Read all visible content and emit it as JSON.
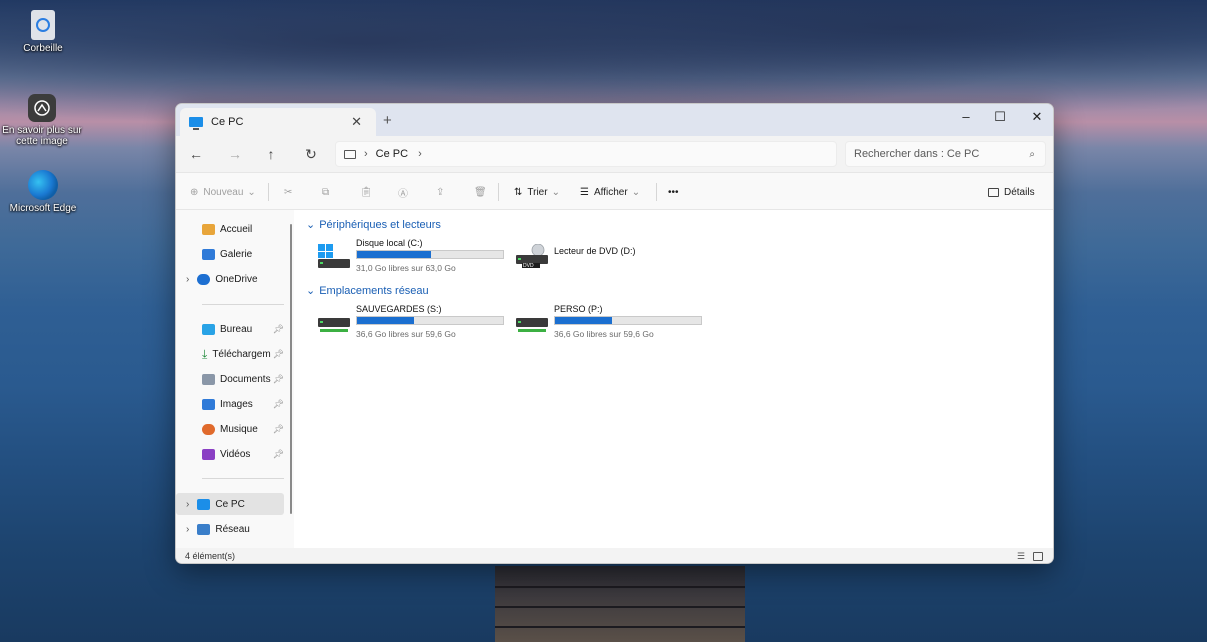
{
  "desktop": {
    "icons": [
      {
        "label": "Corbeille",
        "icon": "recycle-bin-icon"
      },
      {
        "label": "En savoir plus sur cette image",
        "icon": "learn-more-icon"
      },
      {
        "label": "Microsoft Edge",
        "icon": "edge-icon"
      }
    ]
  },
  "window": {
    "tab_title": "Ce PC",
    "tab_close": "✕",
    "new_tab": "+",
    "controls": {
      "minimize": "–",
      "maximize": "☐",
      "close": "✕"
    },
    "breadcrumb": [
      "Ce PC"
    ],
    "search_placeholder": "Rechercher dans : Ce PC",
    "toolbar": {
      "new_label": "Nouveau",
      "sort_label": "Trier",
      "view_label": "Afficher",
      "more_label": "•••",
      "details_label": "Détails"
    },
    "sidebar": {
      "items": [
        {
          "label": "Accueil"
        },
        {
          "label": "Galerie"
        },
        {
          "label": "OneDrive"
        },
        {
          "label": "Bureau"
        },
        {
          "label": "Téléchargem"
        },
        {
          "label": "Documents"
        },
        {
          "label": "Images"
        },
        {
          "label": "Musique"
        },
        {
          "label": "Vidéos"
        },
        {
          "label": "Ce PC"
        },
        {
          "label": "Réseau"
        }
      ]
    },
    "groups": [
      {
        "header": "Périphériques et lecteurs",
        "items": [
          {
            "name": "Disque local (C:)",
            "free": "31,0 Go libres sur 63,0 Go",
            "used_fraction": 0.51
          },
          {
            "name": "Lecteur de DVD (D:)",
            "badge": "DVD"
          }
        ]
      },
      {
        "header": "Emplacements réseau",
        "items": [
          {
            "name": "SAUVEGARDES (S:)",
            "free": "36,6 Go libres sur 59,6 Go",
            "used_fraction": 0.39
          },
          {
            "name": "PERSO (P:)",
            "free": "36,6 Go libres sur 59,6 Go",
            "used_fraction": 0.39
          }
        ]
      }
    ],
    "status": "4 élément(s)"
  }
}
